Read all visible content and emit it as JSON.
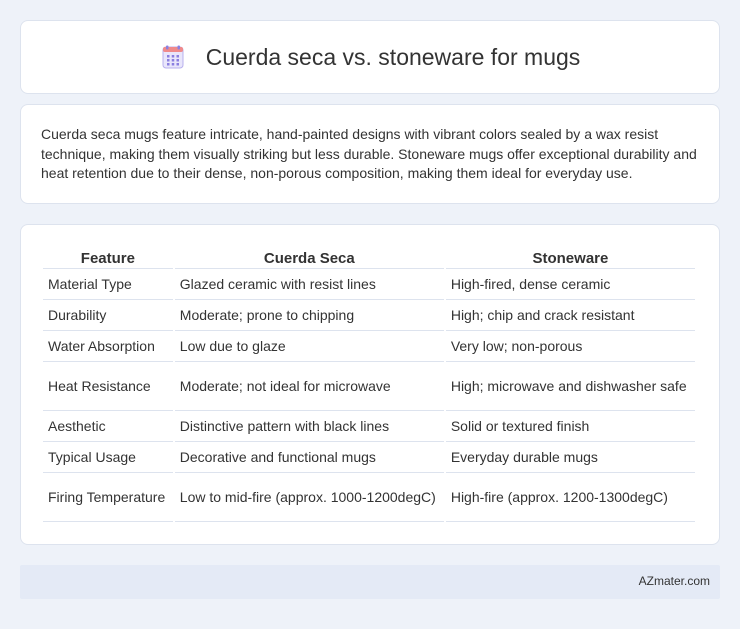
{
  "header": {
    "title": "Cuerda seca vs. stoneware for mugs",
    "icon": "calendar-grid-icon"
  },
  "summary": {
    "text": "Cuerda seca mugs feature intricate, hand-painted designs with vibrant colors sealed by a wax resist technique, making them visually striking but less durable. Stoneware mugs offer exceptional durability and heat retention due to their dense, non-porous composition, making them ideal for everyday use."
  },
  "table": {
    "headers": [
      "Feature",
      "Cuerda Seca",
      "Stoneware"
    ],
    "rows": [
      [
        "Material Type",
        "Glazed ceramic with resist lines",
        "High-fired, dense ceramic"
      ],
      [
        "Durability",
        "Moderate; prone to chipping",
        "High; chip and crack resistant"
      ],
      [
        "Water Absorption",
        "Low due to glaze",
        "Very low; non-porous"
      ],
      [
        "Heat Resistance",
        "Moderate; not ideal for microwave",
        "High; microwave and dishwasher safe"
      ],
      [
        "Aesthetic",
        "Distinctive pattern with black lines",
        "Solid or textured finish"
      ],
      [
        "Typical Usage",
        "Decorative and functional mugs",
        "Everyday durable mugs"
      ],
      [
        "Firing Temperature",
        "Low to mid-fire (approx. 1000-1200degC)",
        "High-fire (approx. 1200-1300degC)"
      ]
    ]
  },
  "footer": {
    "brand": "AZmater.com"
  },
  "colors": {
    "accent": "#7b6fd6",
    "icon_top": "#f07b7b",
    "background": "#eef2f9"
  }
}
